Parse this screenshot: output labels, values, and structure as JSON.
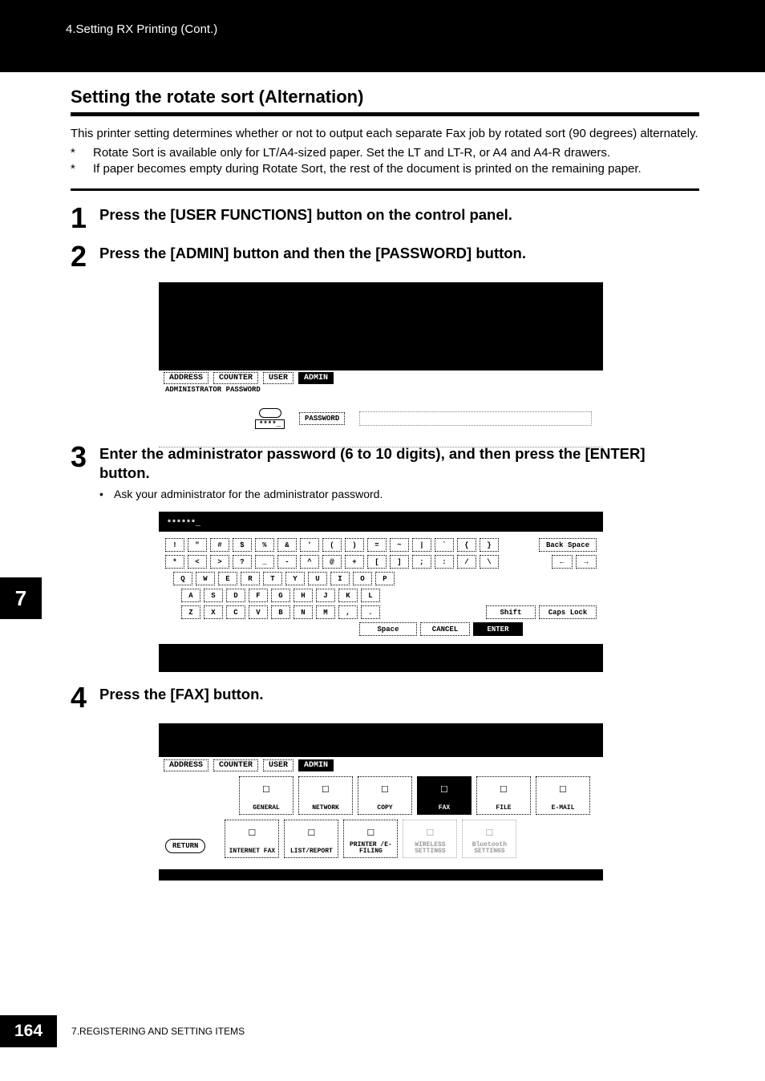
{
  "header": {
    "breadcrumb": "4.Setting RX Printing (Cont.)"
  },
  "section": {
    "title": "Setting the rotate sort (Alternation)"
  },
  "intro": {
    "para": "This printer setting determines whether or not to output each separate Fax job by rotated sort (90 degrees) alternately.",
    "notes": [
      "Rotate Sort is available only for LT/A4-sized paper. Set the LT and LT-R, or A4 and A4-R drawers.",
      "If paper becomes empty during Rotate Sort, the rest of the document is printed on the remaining paper."
    ]
  },
  "steps": [
    {
      "num": "1",
      "title": "Press the [USER FUNCTIONS] button on the control panel."
    },
    {
      "num": "2",
      "title": "Press the [ADMIN] button and then the [PASSWORD] button."
    },
    {
      "num": "3",
      "title": "Enter the administrator password (6 to 10 digits), and then press the [ENTER] button.",
      "sub": "Ask your administrator for the administrator password."
    },
    {
      "num": "4",
      "title": "Press the [FAX] button."
    }
  ],
  "screenshot1": {
    "tabs": [
      "ADDRESS",
      "COUNTER",
      "USER",
      "ADMIN"
    ],
    "active_tab": "ADMIN",
    "caption": "ADMINISTRATOR PASSWORD",
    "mask": "****_",
    "password_btn": "PASSWORD"
  },
  "screenshot2": {
    "top_mask": "******_",
    "rows": {
      "r1": [
        "!",
        "\"",
        "#",
        "$",
        "%",
        "&",
        "'",
        "(",
        ")",
        "=",
        "~",
        "|",
        "`",
        "{",
        "}"
      ],
      "r1_right": "Back Space",
      "r2": [
        "*",
        "<",
        ">",
        "?",
        "_",
        "-",
        "^",
        "@",
        "+",
        "[",
        "]",
        ";",
        ":",
        "/",
        "\\"
      ],
      "r2_right": [
        "←",
        "→"
      ],
      "r3": [
        "Q",
        "W",
        "E",
        "R",
        "T",
        "Y",
        "U",
        "I",
        "O",
        "P"
      ],
      "r4": [
        "A",
        "S",
        "D",
        "F",
        "G",
        "H",
        "J",
        "K",
        "L"
      ],
      "r5": [
        "Z",
        "X",
        "C",
        "V",
        "B",
        "N",
        "M",
        ",",
        "."
      ],
      "r5_right": [
        "Shift",
        "Caps Lock"
      ],
      "bottom": [
        "Space",
        "CANCEL",
        "ENTER"
      ]
    }
  },
  "screenshot3": {
    "tabs": [
      "ADDRESS",
      "COUNTER",
      "USER",
      "ADMIN"
    ],
    "active_tab": "ADMIN",
    "grid_row1": [
      "GENERAL",
      "NETWORK",
      "COPY",
      "FAX",
      "FILE",
      "E-MAIL"
    ],
    "grid_row1_active": "FAX",
    "return_btn": "RETURN",
    "grid_row2": [
      "INTERNET FAX",
      "LIST/REPORT",
      "PRINTER\n/E-FILING",
      "WIRELESS\nSETTINGS",
      "Bluetooth\nSETTINGS"
    ],
    "grid_row2_dim": [
      "WIRELESS\nSETTINGS",
      "Bluetooth\nSETTINGS"
    ]
  },
  "side_tab": "7",
  "footer": {
    "page": "164",
    "text": "7.REGISTERING AND SETTING ITEMS"
  }
}
